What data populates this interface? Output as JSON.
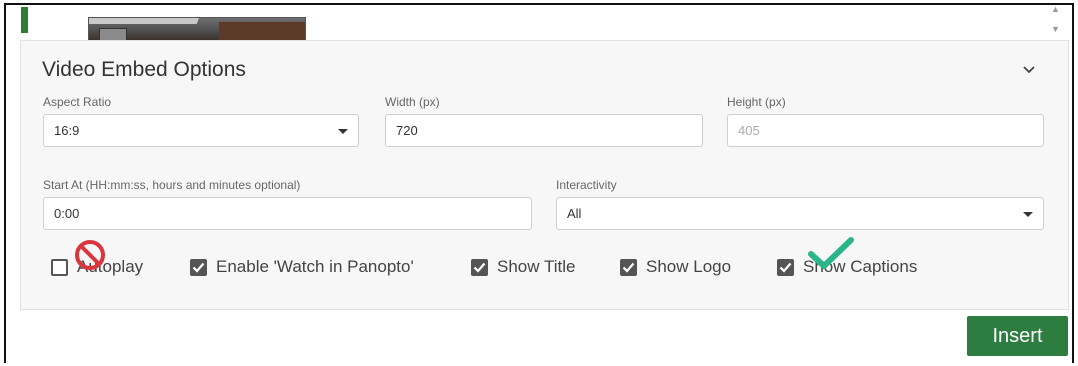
{
  "panel": {
    "title": "Video Embed Options"
  },
  "fields": {
    "aspect_ratio": {
      "label": "Aspect Ratio",
      "value": "16:9"
    },
    "width": {
      "label": "Width (px)",
      "value": "720"
    },
    "height": {
      "label": "Height (px)",
      "value": "405"
    },
    "start_at": {
      "label": "Start At (HH:mm:ss, hours and minutes optional)",
      "value": "0:00"
    },
    "interactivity": {
      "label": "Interactivity",
      "value": "All"
    }
  },
  "checkboxes": {
    "autoplay": {
      "label": "Autoplay",
      "checked": false
    },
    "watch_in_panopto": {
      "label": "Enable 'Watch in Panopto'",
      "checked": true
    },
    "show_title": {
      "label": "Show Title",
      "checked": true
    },
    "show_logo": {
      "label": "Show Logo",
      "checked": true
    },
    "show_captions": {
      "label": "Show Captions",
      "checked": true
    }
  },
  "annotations": {
    "prohibited_color": "#d9363e",
    "approved_color": "#2bb58a"
  },
  "actions": {
    "insert_label": "Insert"
  },
  "icons": [
    "chevron-down-icon",
    "checkmark-icon",
    "no-symbol-icon",
    "scroll-arrow-icon"
  ],
  "colors": {
    "accent": "#2e7d40",
    "panel_bg": "#f7f7f7"
  }
}
